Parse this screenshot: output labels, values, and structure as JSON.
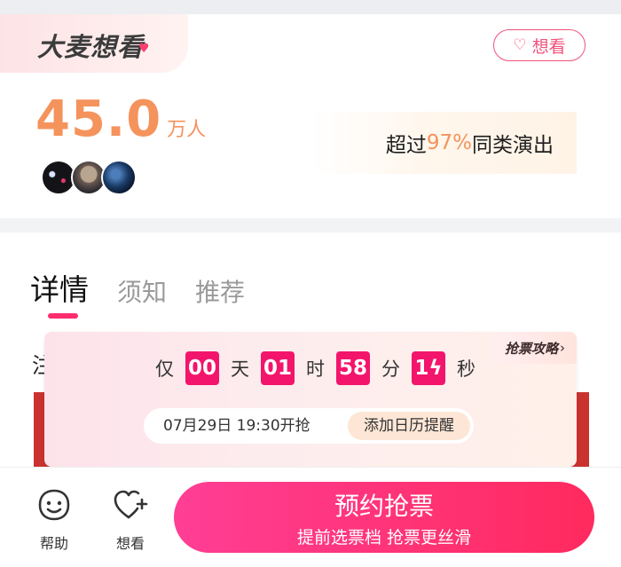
{
  "want_section": {
    "brand_title": "大麦想看",
    "want_button_label": "想看",
    "count": "45.0",
    "count_unit": "万人",
    "exceed_prefix": "超过",
    "exceed_percent": "97%",
    "exceed_suffix": "同类演出"
  },
  "tabs": [
    {
      "label": "详情",
      "active": true
    },
    {
      "label": "须知",
      "active": false
    },
    {
      "label": "推荐",
      "active": false
    }
  ],
  "background_text": "注",
  "countdown": {
    "prefix": "仅",
    "days": "00",
    "days_unit": "天",
    "hours": "01",
    "hours_unit": "时",
    "minutes": "58",
    "minutes_unit": "分",
    "seconds": "1ϟ",
    "seconds_unit": "秒",
    "guide_label": "抢票攻略",
    "start_time": "07月29日 19:30开抢",
    "add_calendar": "添加日历提醒"
  },
  "bottom_bar": {
    "help_label": "帮助",
    "want_label": "想看",
    "cta_main": "预约抢票",
    "cta_sub": "提前选票档 抢票更丝滑"
  },
  "colors": {
    "accent_pink": "#f3156b",
    "count_orange": "#f5935c",
    "cta_start": "#ff3e95",
    "cta_end": "#ff2a5e"
  }
}
